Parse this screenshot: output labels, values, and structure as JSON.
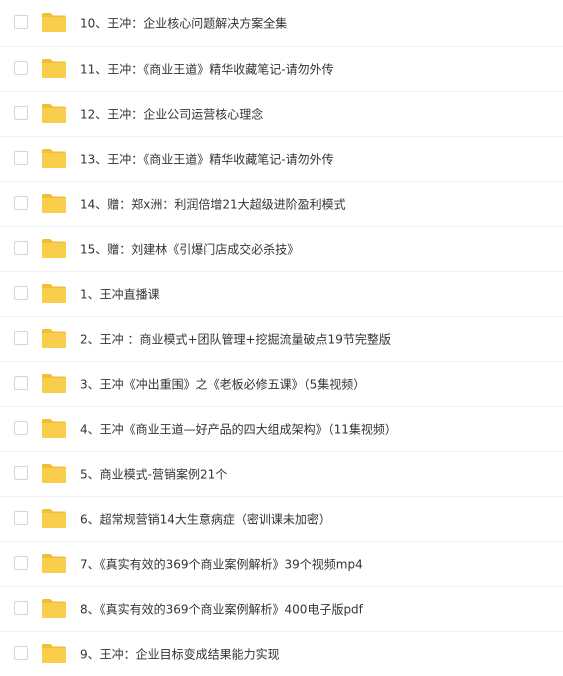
{
  "colors": {
    "folder": "#F9CE4D",
    "folder_tab": "#F2BE34",
    "text": "#333333",
    "divider": "#F0F0F0",
    "checkbox_border": "#D4D4D4"
  },
  "icons": {
    "row_icon": "folder-icon"
  },
  "files": [
    {
      "name": "10、王冲：企业核心问题解决方案全集"
    },
    {
      "name": "11、王冲：《商业王道》精华收藏笔记-请勿外传"
    },
    {
      "name": "12、王冲：企业公司运营核心理念"
    },
    {
      "name": "13、王冲：《商业王道》精华收藏笔记-请勿外传"
    },
    {
      "name": "14、赠：郑x洲：利润倍增21大超级进阶盈利模式"
    },
    {
      "name": "15、赠：刘建林《引爆门店成交必杀技》"
    },
    {
      "name": "1、王冲直播课"
    },
    {
      "name": "2、王冲 ：商业模式+团队管理+挖掘流量破点19节完整版"
    },
    {
      "name": "3、王冲《冲出重围》之《老板必修五课》（5集视频）"
    },
    {
      "name": "4、王冲《商业王道—好产品的四大组成架构》（11集视频）"
    },
    {
      "name": "5、商业模式-营销案例21个"
    },
    {
      "name": "6、超常规营销14大生意病症（密训课未加密）"
    },
    {
      "name": "7、《真实有效的369个商业案例解析》39个视频mp4"
    },
    {
      "name": "8、《真实有效的369个商业案例解析》400电子版pdf"
    },
    {
      "name": "9、王冲：企业目标变成结果能力实现"
    }
  ]
}
